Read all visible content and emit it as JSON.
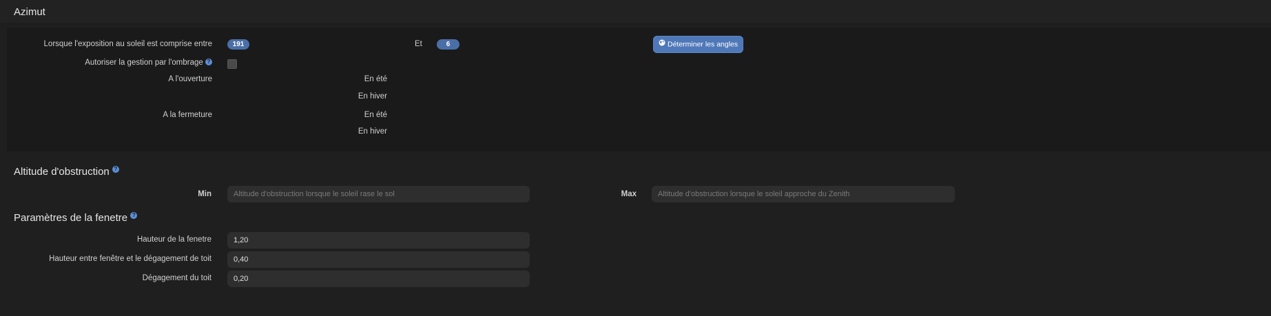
{
  "azimut": {
    "title": "Azimut",
    "exposure_label": "Lorsque l'exposition au soleil est comprise entre",
    "exposure_from": "191",
    "and_label": "Et",
    "exposure_to": "6",
    "determine_button": "Déterminer les angles",
    "shading_label": "Autoriser la gestion par l'ombrage",
    "help_glyph": "?",
    "opening_label": "A l'ouverture",
    "closing_label": "A la fermeture",
    "summer_label": "En été",
    "winter_label": "En hiver"
  },
  "obstruction": {
    "title": "Altitude d'obstruction",
    "min_label": "Min",
    "min_placeholder": "Altitude d'obstruction lorsque le soleil rase le sol",
    "max_label": "Max",
    "max_placeholder": "Altitude d'obstruction lorsque le soleil approche du Zenith"
  },
  "window": {
    "title": "Paramètres de la fenetre",
    "height_label": "Hauteur de la fenetre",
    "height_value": "1,20",
    "gap_label": "Hauteur entre fenêtre et le dégagement de toit",
    "gap_value": "0,40",
    "clearance_label": "Dégagement du toit",
    "clearance_value": "0,20"
  },
  "colors": {
    "background": "#1f1f1f",
    "panel": "#1a1a1a",
    "accent": "#4a6fa8",
    "button": "#4f78b8",
    "input": "#2e2e2e"
  },
  "icons": {
    "help": "help-circle-icon",
    "determine": "globe-icon"
  }
}
